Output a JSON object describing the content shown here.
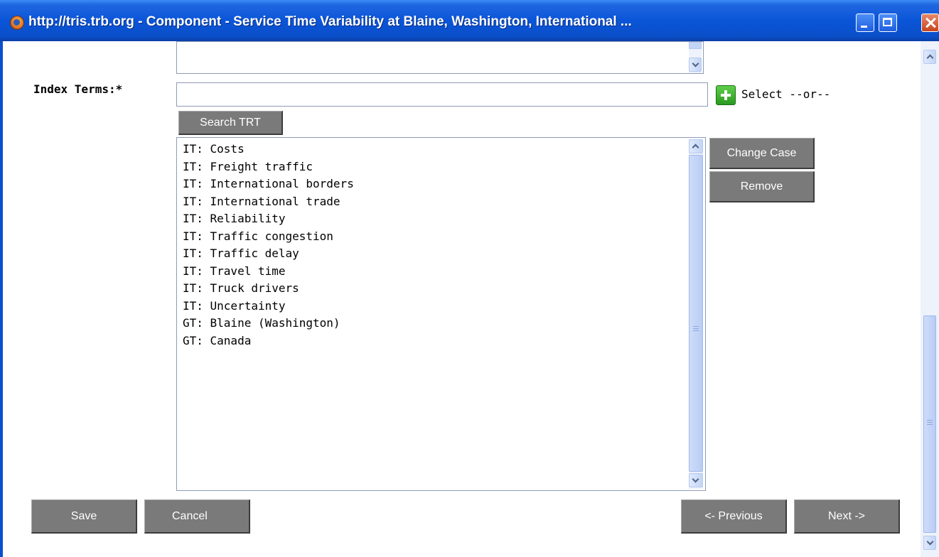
{
  "window": {
    "title": "http://tris.trb.org - Component - Service Time Variability at Blaine, Washington, International ...",
    "icon": "firefox-icon"
  },
  "form": {
    "index_terms_label": "Index Terms:*",
    "term_input_value": "",
    "select_text": "Select --or--",
    "search_button": "Search TRT",
    "change_case_button": "Change Case",
    "remove_button": "Remove",
    "terms": [
      "IT: Costs",
      "IT: Freight traffic",
      "IT: International borders",
      "IT: International trade",
      "IT: Reliability",
      "IT: Traffic congestion",
      "IT: Traffic delay",
      "IT: Travel time",
      "IT: Truck drivers",
      "IT: Uncertainty",
      "GT: Blaine (Washington)",
      "GT: Canada"
    ]
  },
  "footer": {
    "save": "Save",
    "cancel": "Cancel",
    "previous": "<- Previous",
    "next": "Next ->"
  },
  "colors": {
    "titlebar": "#0a55d8",
    "button_bg": "#7a7a7a",
    "add_icon": "#2a9a20"
  }
}
